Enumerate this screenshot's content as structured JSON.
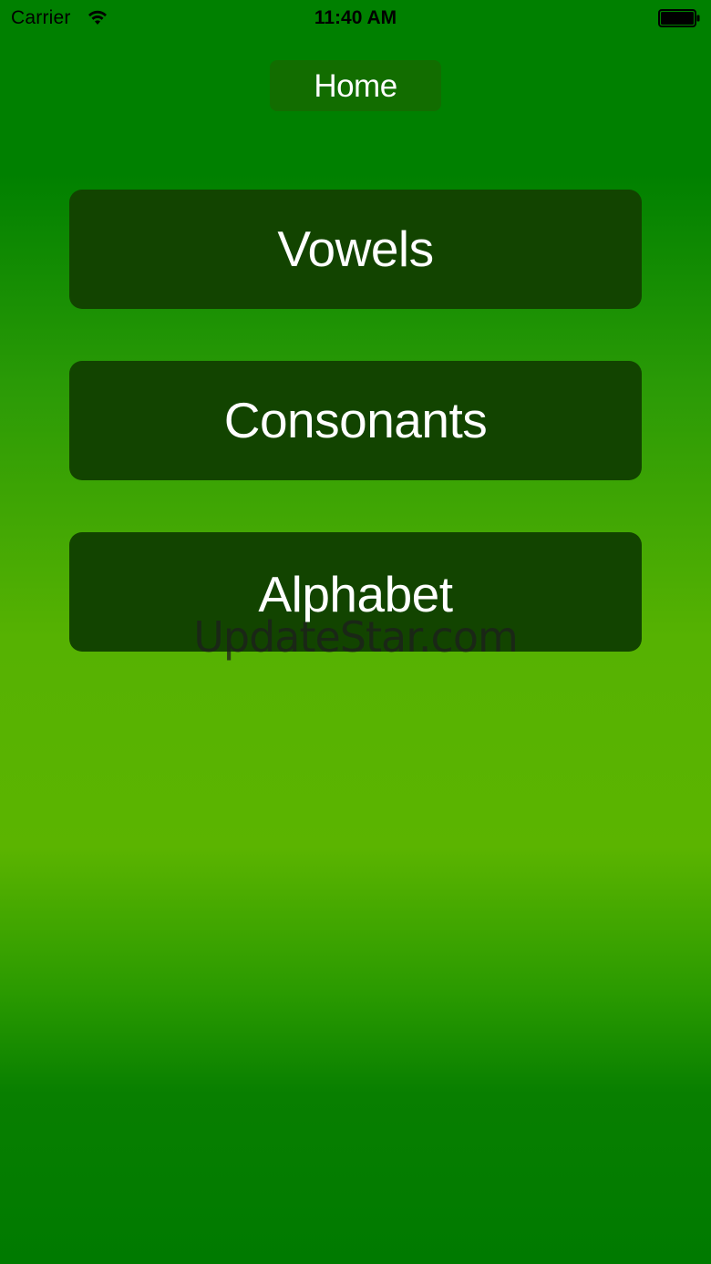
{
  "status_bar": {
    "carrier": "Carrier",
    "time": "11:40 AM",
    "icons": [
      "wifi-icon",
      "battery-icon"
    ]
  },
  "nav": {
    "home_label": "Home"
  },
  "menu": {
    "items": [
      {
        "label": "Vowels"
      },
      {
        "label": "Consonants"
      },
      {
        "label": "Alphabet"
      }
    ]
  },
  "watermark": "UpdateStar.com",
  "colors": {
    "background_top": "#008000",
    "background_mid": "#5bb400",
    "button_dark": "#124400",
    "home_button": "#126d00",
    "text": "#ffffff"
  }
}
